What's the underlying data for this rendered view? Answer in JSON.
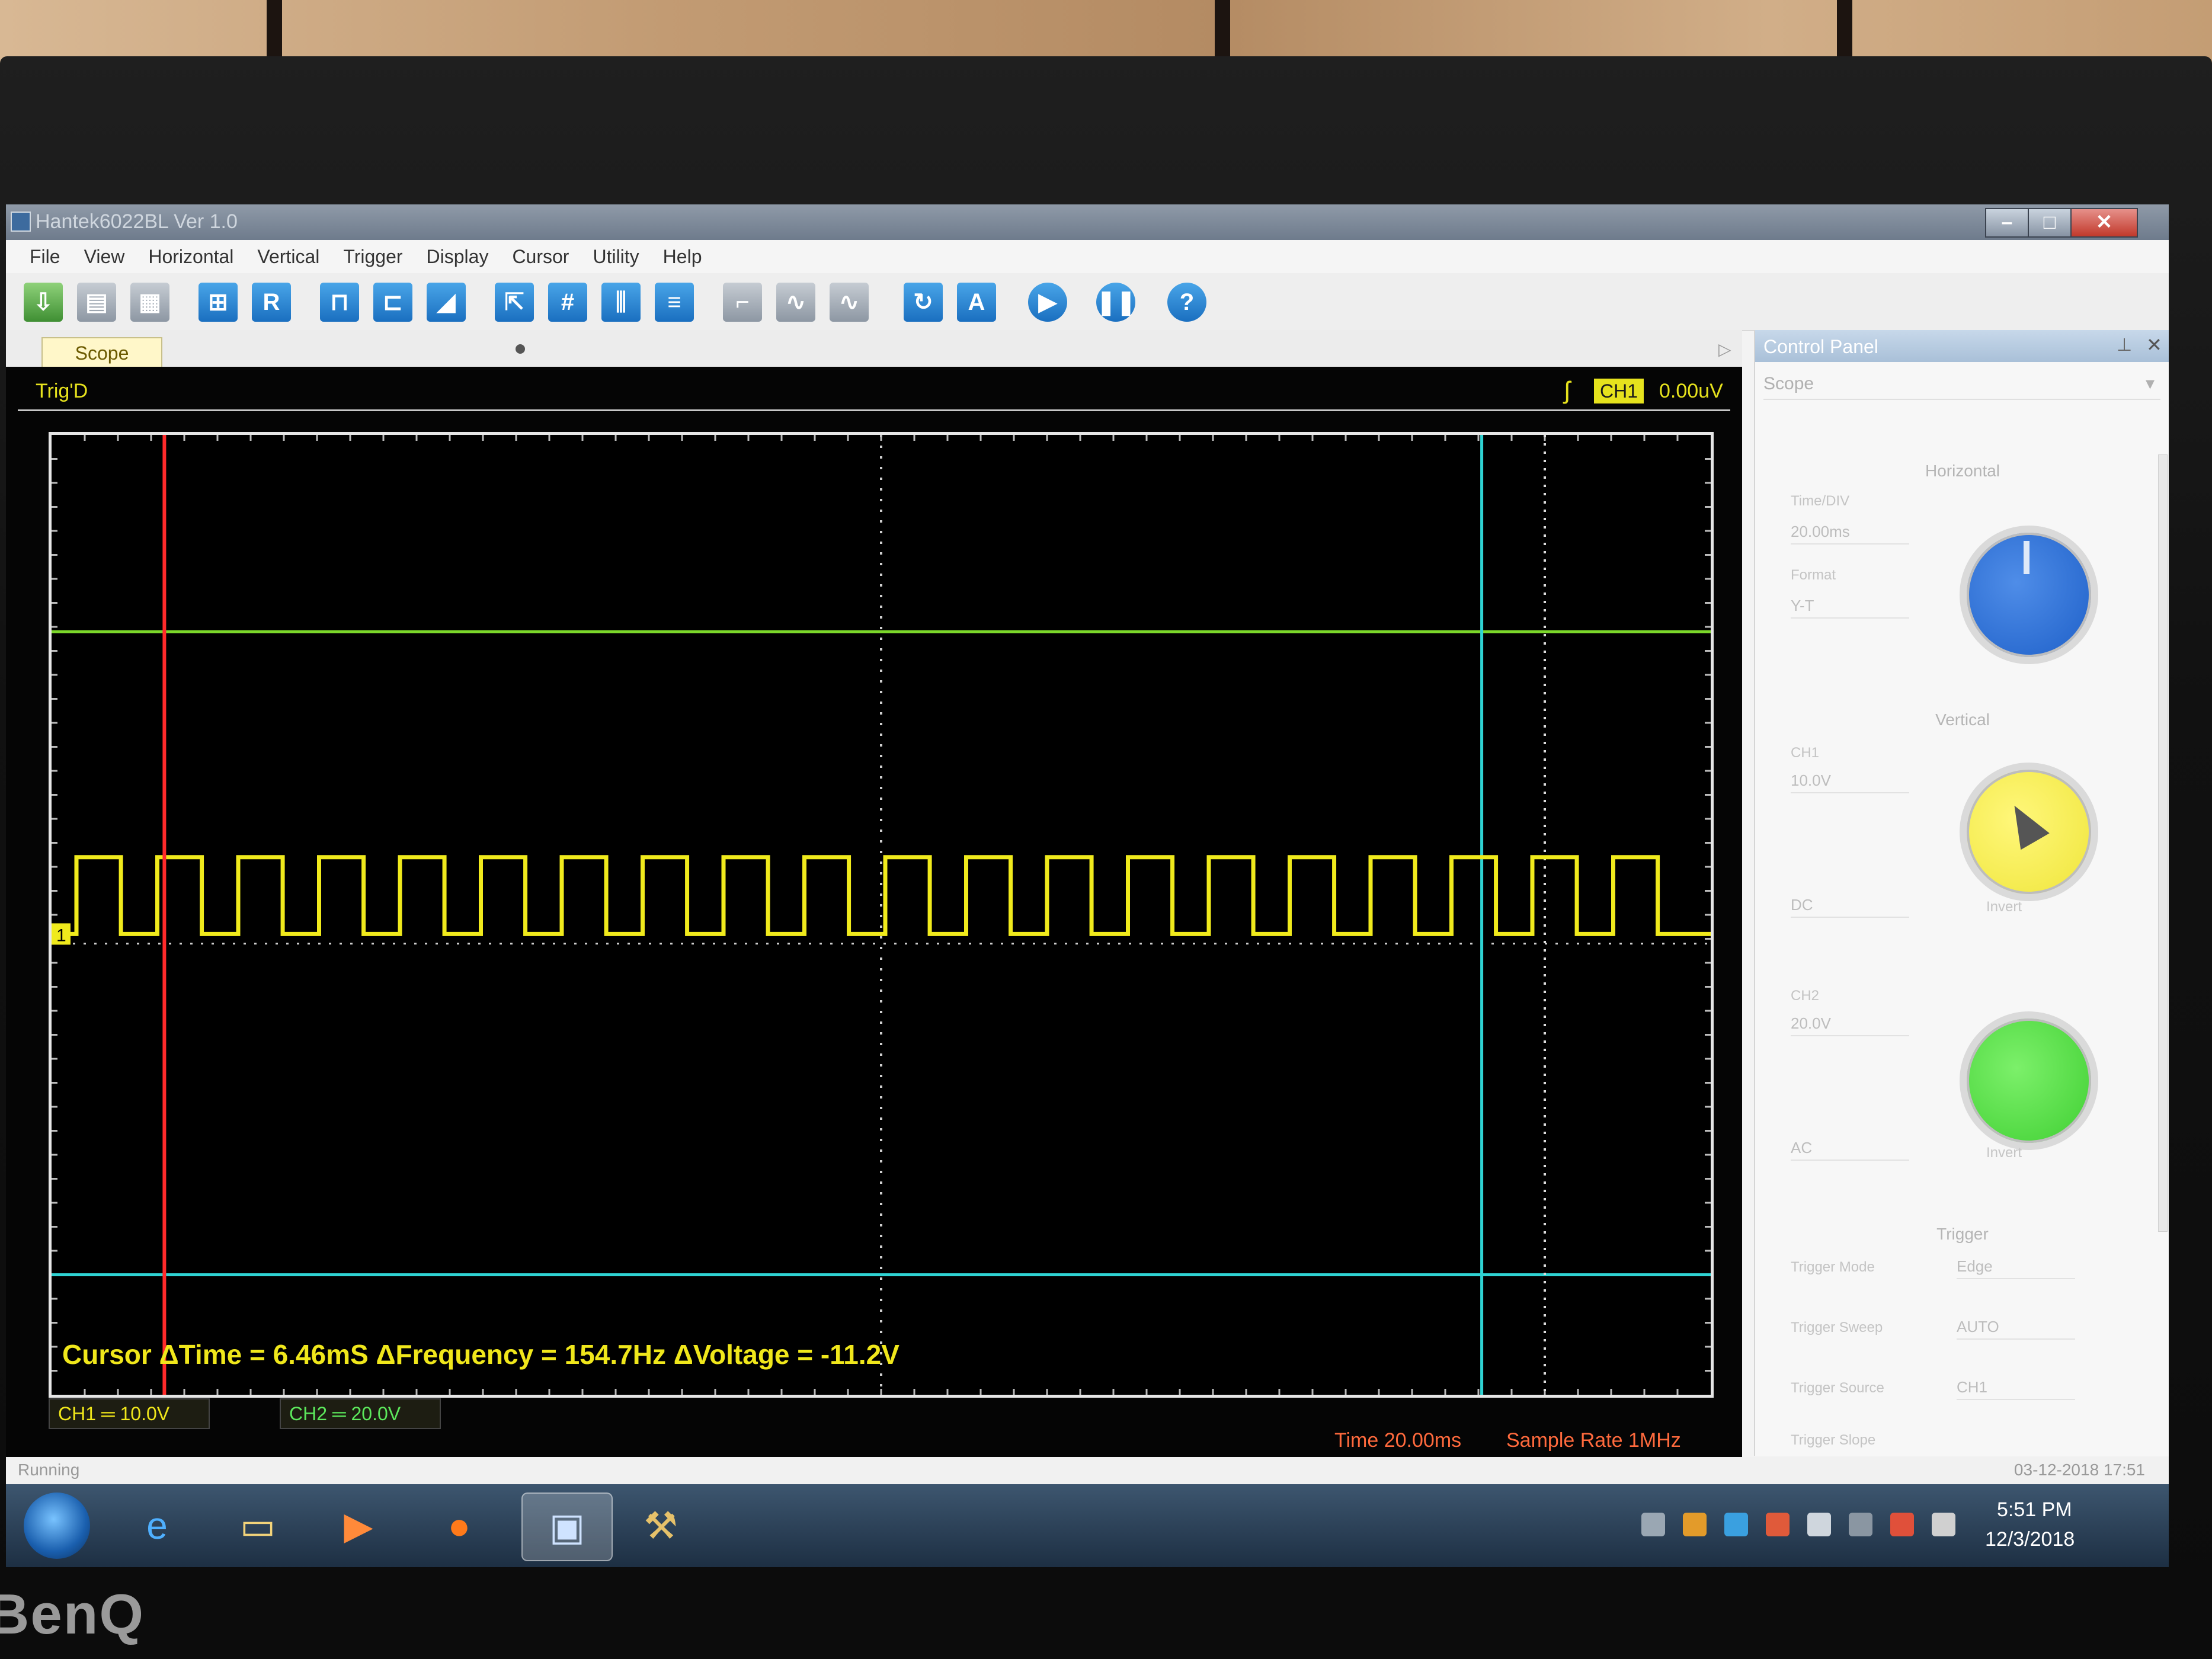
{
  "window": {
    "title": "Hantek6022BL Ver 1.0",
    "buttons": {
      "minimize": "–",
      "maximize": "□",
      "close": "✕"
    }
  },
  "menu": [
    "File",
    "View",
    "Horizontal",
    "Vertical",
    "Trigger",
    "Display",
    "Cursor",
    "Utility",
    "Help"
  ],
  "toolbar": {
    "icons": [
      "open-icon",
      "save-icon",
      "print-icon",
      "auto-set-icon",
      "reference-icon",
      "edge-trigger-icon",
      "pulse-trigger-icon",
      "slope-trigger-icon",
      "cursor-icon",
      "grid-icon",
      "vertical-cursor-icon",
      "horizontal-cursor-icon",
      "step-icon",
      "sine-icon",
      "wave-icon",
      "calibrate-icon",
      "auto-icon",
      "run-icon",
      "pause-icon",
      "help-icon"
    ],
    "reference_label": "R",
    "help_label": "?"
  },
  "tabs": [
    {
      "label": "Scope",
      "active": true
    }
  ],
  "scope": {
    "trig_status": "Trig'D",
    "trigger_channel": "CH1",
    "trigger_level": "0.00uV",
    "cursor_readout": "Cursor   ΔTime = 6.46mS  ΔFrequency = 154.7Hz  ΔVoltage = -11.2V",
    "ch1": "CH1 ═  10.0V",
    "ch2": "CH2 ═  20.0V",
    "time": "Time 20.00ms",
    "sample_rate": "Sample Rate 1MHz",
    "ch1_marker": "1",
    "signal": {
      "pulses": 20,
      "duty_cycle": 0.55,
      "color": "#f0ea1c"
    },
    "colors": {
      "ch1": "#f0ea1c",
      "ch2": "#5ce85c",
      "cursor_h": "#2fd3d3",
      "cursor_red": "#ff2a2a"
    }
  },
  "status_bar": {
    "text": "Running",
    "datetime": "03-12-2018  17:51"
  },
  "control_panel": {
    "title": "Control Panel",
    "scope_select": "Scope",
    "horizontal": {
      "section": "Horizontal",
      "time_div_label": "Time/DIV",
      "time_div": "20.00ms",
      "format_label": "Format",
      "format": "Y-T"
    },
    "vertical": {
      "section": "Vertical",
      "ch1_label": "CH1",
      "ch1_volt": "10.0V",
      "ch1_coupling": "DC",
      "ch2_label": "CH2",
      "ch2_volt": "20.0V",
      "ch2_coupling": "AC",
      "invert": "Invert"
    },
    "trigger": {
      "section": "Trigger",
      "mode_label": "Trigger Mode",
      "mode": "Edge",
      "sweep_label": "Trigger Sweep",
      "sweep": "AUTO",
      "source_label": "Trigger Source",
      "source": "CH1",
      "slope_label": "Trigger Slope"
    }
  },
  "taskbar": {
    "apps": [
      "ie-icon",
      "explorer-icon",
      "media-player-icon",
      "firefox-icon",
      "scope-app-icon",
      "tools-icon"
    ],
    "clock_time": "5:51 PM",
    "clock_date": "12/3/2018"
  },
  "monitor_brand": "BenQ"
}
